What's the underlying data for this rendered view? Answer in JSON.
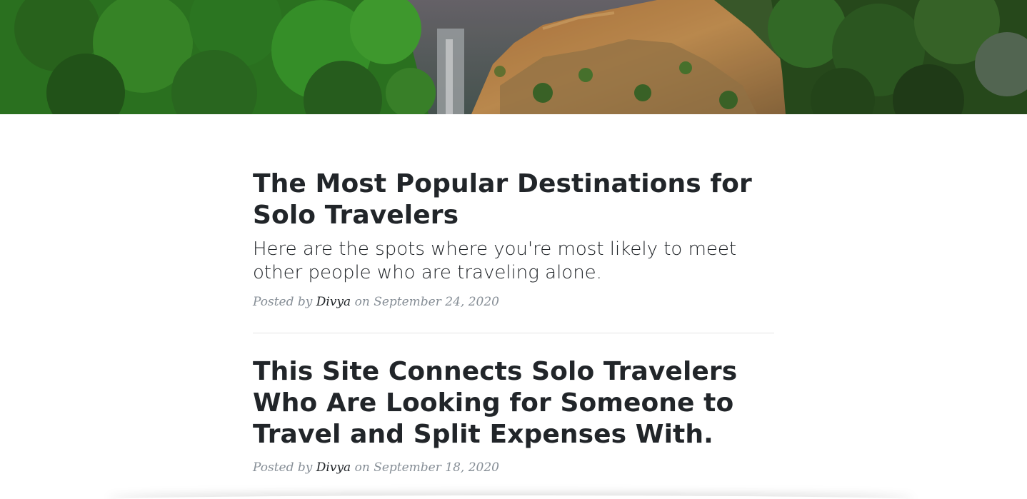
{
  "header": {
    "background_image": "waterfall-forest-landscape"
  },
  "posts": [
    {
      "title": "The Most Popular Destinations for Solo Travelers",
      "subtitle": "Here are the spots where you're most likely to meet other people who are traveling alone.",
      "meta_prefix": "Posted by ",
      "author": "Divya",
      "meta_on": " on ",
      "date": "September 24, 2020"
    },
    {
      "title": "This Site Connects Solo Travelers Who Are Looking for Someone to Travel and Split Expenses With.",
      "meta_prefix": "Posted by ",
      "author": "Divya",
      "meta_on": " on ",
      "date": "September 18, 2020"
    }
  ],
  "colors": {
    "text": "#212529",
    "meta": "#868e96",
    "divider": "#e3e3e3"
  }
}
